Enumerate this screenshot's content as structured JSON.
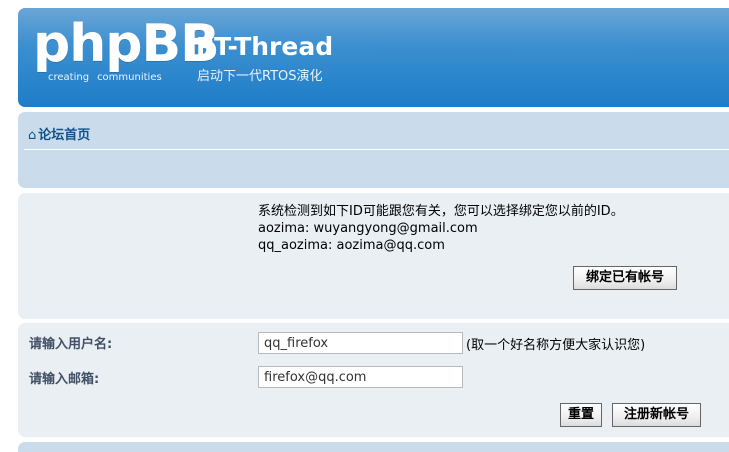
{
  "header": {
    "logo_text": "phpBB",
    "logo_reg": "®",
    "logo_sub_left": "creating",
    "logo_sub_right": "communities",
    "site_title": "RT-Thread",
    "site_description": "启动下一代RTOS演化"
  },
  "nav": {
    "home_icon": "⌂",
    "home_label": "论坛首页"
  },
  "notice": {
    "message": "系统检测到如下ID可能跟您有关，您可以选择绑定您以前的ID。",
    "accounts": [
      "aozima: wuyangyong@gmail.com",
      "qq_aozima: aozima@qq.com"
    ],
    "bind_button": "绑定已有帐号"
  },
  "form": {
    "username_label": "请输入用户名:",
    "username_value": "qq_firefox",
    "username_hint": "(取一个好名称方便大家认识您)",
    "email_label": "请输入邮箱:",
    "email_value": "firefox@qq.com",
    "reset_button": "重置",
    "register_button": "注册新帐号"
  },
  "colors": {
    "header_blue": "#1d7dc7",
    "nav_bg": "#cadceb",
    "panel_bg": "#e9eff3",
    "link_blue": "#105289"
  }
}
